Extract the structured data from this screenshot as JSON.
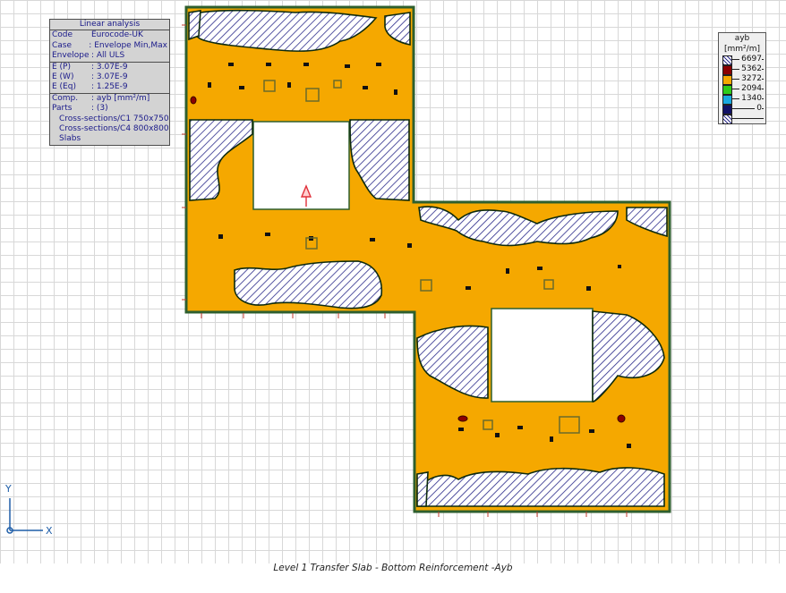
{
  "info_panel": {
    "title": "Linear analysis",
    "rows": [
      {
        "key": "Code",
        "value": "Eurocode-UK"
      },
      {
        "key": "Case",
        "value": ": Envelope Min,Max"
      },
      {
        "key": "Envelope",
        "value": ": All ULS"
      },
      {
        "key": "E (P)",
        "value": ": 3.07E-9"
      },
      {
        "key": "E (W)",
        "value": ": 3.07E-9"
      },
      {
        "key": "E (Eq)",
        "value": ": 1.25E-9"
      },
      {
        "key": "Comp.",
        "value": ": ayb [mm²/m]"
      },
      {
        "key": "Parts",
        "value": ": (3)"
      }
    ],
    "parts": [
      "Cross-sections/C1 750x750",
      "Cross-sections/C4 800x800",
      "Slabs"
    ]
  },
  "legend": {
    "title": "ayb",
    "unit": "[mm²/m]",
    "levels": [
      {
        "value": "6697",
        "color": "#ffffff",
        "hatched": true
      },
      {
        "value": "5362",
        "color": "#8b0000"
      },
      {
        "value": "3272",
        "color": "#f5a800"
      },
      {
        "value": "2094",
        "color": "#2ecc1a"
      },
      {
        "value": "1340",
        "color": "#19a9e0"
      },
      {
        "value": "0",
        "color": "#111166"
      },
      {
        "value": "",
        "color": "#ffffff",
        "hatched": true
      }
    ]
  },
  "axes": {
    "x": "X",
    "y": "Y"
  },
  "caption": "Level 1 Transfer Slab - Bottom Reinforcement -Ayb",
  "colors": {
    "slab": "#f5a800",
    "hatch": "#2a2a8a",
    "edge": "#1a4a1a",
    "grid": "#d8d8d8"
  }
}
